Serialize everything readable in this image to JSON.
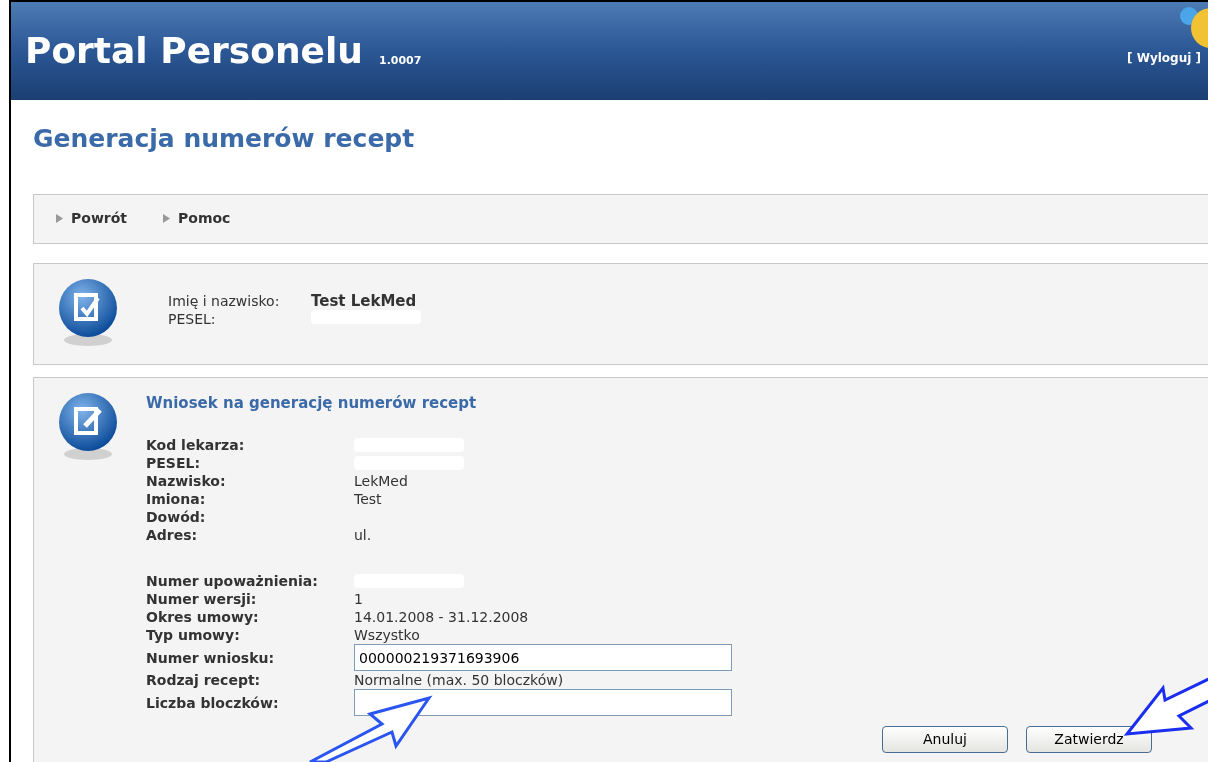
{
  "header": {
    "title": "Portal Personelu",
    "version": "1.0007",
    "logout": "[ Wyloguj ]"
  },
  "page_title": "Generacja numerów recept",
  "nav": [
    {
      "label": "Powrót"
    },
    {
      "label": "Pomoc"
    }
  ],
  "person": {
    "fields": [
      {
        "label": "Imię i nazwisko:",
        "value": "Test LekMed",
        "kind": "text"
      },
      {
        "label": "PESEL:",
        "kind": "redacted"
      }
    ]
  },
  "request": {
    "title": "Wniosek na generację numerów recept",
    "groups": [
      [
        {
          "label": "Kod lekarza:",
          "kind": "redacted"
        },
        {
          "label": "PESEL:",
          "kind": "redacted"
        },
        {
          "label": "Nazwisko:",
          "value": "LekMed",
          "kind": "text"
        },
        {
          "label": "Imiona:",
          "value": "Test",
          "kind": "text"
        },
        {
          "label": "Dowód:",
          "kind": "text"
        },
        {
          "label": "Adres:",
          "value": "ul.",
          "kind": "text"
        }
      ],
      [
        {
          "label": "Numer upoważnienia:",
          "kind": "redacted"
        },
        {
          "label": "Numer wersji:",
          "value": "1",
          "kind": "text"
        },
        {
          "label": "Okres umowy:",
          "value": "14.01.2008 - 31.12.2008",
          "kind": "text"
        },
        {
          "label": "Typ umowy:",
          "value": "Wszystko",
          "kind": "text"
        },
        {
          "label": "Numer wniosku:",
          "value": "000000219371693906",
          "kind": "input"
        },
        {
          "label": "Rodzaj recept:",
          "value": "Normalne (max. 50 bloczków)",
          "kind": "text"
        },
        {
          "label": "Liczba bloczków:",
          "kind": "input"
        }
      ]
    ],
    "buttons": [
      "Anuluj",
      "Zatwierdz"
    ]
  }
}
